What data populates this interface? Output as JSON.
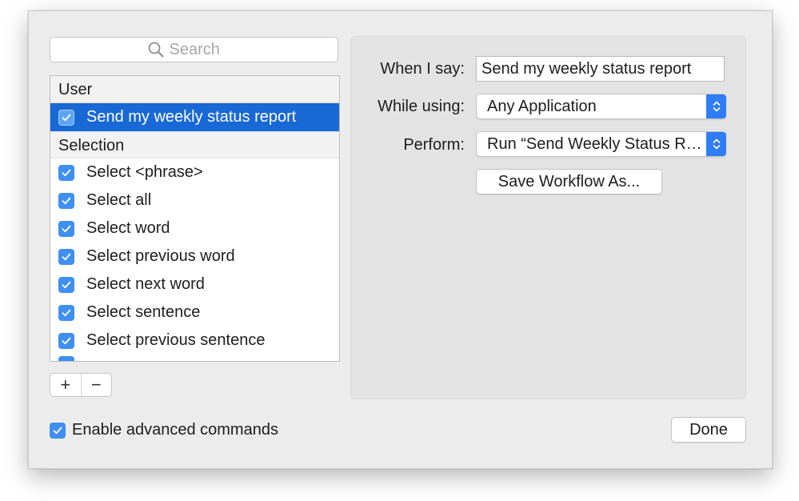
{
  "search": {
    "placeholder": "Search",
    "icon": "magnifier-icon"
  },
  "list": {
    "groups": [
      {
        "header": "User",
        "items": [
          {
            "label": "Send my weekly status report",
            "checked": true,
            "selected": true
          }
        ]
      },
      {
        "header": "Selection",
        "items": [
          {
            "label": "Select <phrase>",
            "checked": true
          },
          {
            "label": "Select all",
            "checked": true
          },
          {
            "label": "Select word",
            "checked": true
          },
          {
            "label": "Select previous word",
            "checked": true
          },
          {
            "label": "Select next word",
            "checked": true
          },
          {
            "label": "Select sentence",
            "checked": true
          },
          {
            "label": "Select previous sentence",
            "checked": true
          }
        ]
      }
    ]
  },
  "list_controls": {
    "add": "+",
    "remove": "−"
  },
  "detail": {
    "when_label": "When I say:",
    "when_value": "Send my weekly status report",
    "while_label": "While using:",
    "while_value": "Any Application",
    "perform_label": "Perform:",
    "perform_value": "Run “Send Weekly Status R…",
    "save_button": "Save Workflow As..."
  },
  "footer": {
    "advanced_label": "Enable advanced commands",
    "advanced_checked": true,
    "done_button": "Done"
  },
  "colors": {
    "accent": "#3f8ff0",
    "selection": "#1868d6",
    "stepper": "#2e7cf6"
  }
}
